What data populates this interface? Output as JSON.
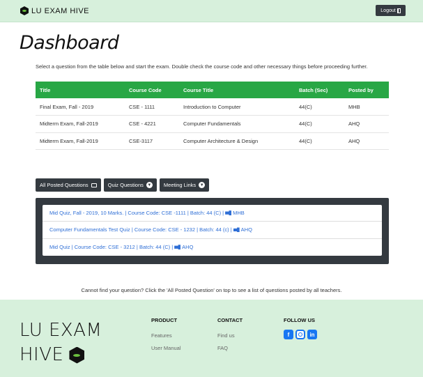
{
  "navbar": {
    "brand": "LU EXAM HIVE",
    "logout_label": "Logout"
  },
  "page": {
    "title": "Dashboard",
    "intro": "Select a question from the table below and start the exam. Double check the course code and other necessary things before proceeding further."
  },
  "table": {
    "headers": [
      "Title",
      "Course Code",
      "Course Title",
      "Batch (Sec)",
      "Posted by"
    ],
    "rows": [
      [
        "Final Exam, Fall - 2019",
        "CSE - 1111",
        "Introduction to Computer",
        "44(C)",
        "MHB"
      ],
      [
        "Midterm Exam, Fall-2019",
        "CSE - 4221",
        "Computer Fundamentals",
        "44(C)",
        "AHQ"
      ],
      [
        "Midterm Exam, Fall-2019",
        "CSE-3117",
        "Computer Architecture & Design",
        "44(C)",
        "AHQ"
      ]
    ]
  },
  "tabs": {
    "all_posted": "All Posted Questions",
    "quiz": "Quiz Questions",
    "meeting": "Meeting Links"
  },
  "quiz_list": [
    {
      "text": "Mid Quiz, Fall - 2019, 10 Marks. | Course Code: CSE -1111 | Batch: 44 (C) |",
      "poster": "MHB"
    },
    {
      "text": "Computer Fundamentals Test Quiz | Course Code: CSE - 1232 | Batch: 44 (c) |",
      "poster": "AHQ"
    },
    {
      "text": "Mid Quiz | Course Code: CSE - 3212 | Batch: 44 (C) |",
      "poster": "AHQ"
    }
  ],
  "hint": "Cannot find your question? Click the 'All Posted Question' on top to see a list of questions posted by all teachers.",
  "footer": {
    "brand_line1": "LU EXAM",
    "brand_line2": "HIVE",
    "product_heading": "PRODUCT",
    "product_links": [
      "Features",
      "User Manual"
    ],
    "contact_heading": "CONTACT",
    "contact_links": [
      "Find us",
      "FAQ"
    ],
    "follow_heading": "FOLLOW US",
    "social": [
      "facebook-icon",
      "instagram-icon",
      "linkedin-icon"
    ]
  },
  "colors": {
    "accent": "#28a745",
    "dark": "#343a40",
    "mint": "#d7f0dc",
    "link": "#2f6fd6"
  }
}
